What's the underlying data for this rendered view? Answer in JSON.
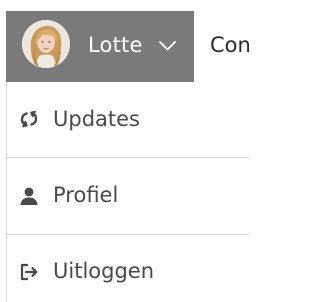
{
  "header": {
    "user": {
      "name": "Lotte",
      "avatar_icon": "user-avatar-photo",
      "chevron_icon": "chevron-down-icon"
    },
    "next_nav_label": "Con"
  },
  "menu": {
    "items": [
      {
        "label": "Updates",
        "icon": "refresh-icon"
      },
      {
        "label": "Profiel",
        "icon": "person-icon"
      },
      {
        "label": "Uitloggen",
        "icon": "logout-icon"
      }
    ]
  },
  "colors": {
    "user_toggle_bg": "#7a7a7a",
    "menu_text": "#4a4a4a",
    "divider": "#d6d6d6"
  }
}
